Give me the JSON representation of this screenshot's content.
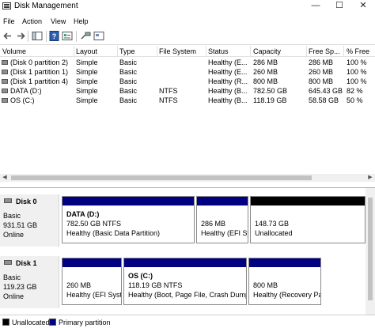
{
  "window": {
    "title": "Disk Management",
    "minimize": "—",
    "maximize": "☐",
    "close": "✕"
  },
  "menu": {
    "file": "File",
    "action": "Action",
    "view": "View",
    "help": "Help"
  },
  "columns": {
    "volume": "Volume",
    "layout": "Layout",
    "type": "Type",
    "fs": "File System",
    "status": "Status",
    "capacity": "Capacity",
    "free": "Free Sp...",
    "pct": "% Free"
  },
  "volumes": [
    {
      "volume": "(Disk 0 partition 2)",
      "layout": "Simple",
      "type": "Basic",
      "fs": "",
      "status": "Healthy (E...",
      "capacity": "286 MB",
      "free": "286 MB",
      "pct": "100 %"
    },
    {
      "volume": "(Disk 1 partition 1)",
      "layout": "Simple",
      "type": "Basic",
      "fs": "",
      "status": "Healthy (E...",
      "capacity": "260 MB",
      "free": "260 MB",
      "pct": "100 %"
    },
    {
      "volume": "(Disk 1 partition 4)",
      "layout": "Simple",
      "type": "Basic",
      "fs": "",
      "status": "Healthy (R...",
      "capacity": "800 MB",
      "free": "800 MB",
      "pct": "100 %"
    },
    {
      "volume": "DATA (D:)",
      "layout": "Simple",
      "type": "Basic",
      "fs": "NTFS",
      "status": "Healthy (B...",
      "capacity": "782.50 GB",
      "free": "645.43 GB",
      "pct": "82 %"
    },
    {
      "volume": "OS (C:)",
      "layout": "Simple",
      "type": "Basic",
      "fs": "NTFS",
      "status": "Healthy (B...",
      "capacity": "118.19 GB",
      "free": "58.58 GB",
      "pct": "50 %"
    }
  ],
  "disks": [
    {
      "name": "Disk 0",
      "kind": "Basic",
      "size": "931.51 GB",
      "state": "Online",
      "partitions": [
        {
          "name": "DATA  (D:)",
          "line1": "782.50 GB NTFS",
          "line2": "Healthy (Basic Data Partition)"
        },
        {
          "name": "",
          "line1": "286 MB",
          "line2": "Healthy (EFI Sy"
        },
        {
          "name": "",
          "line1": "148.73 GB",
          "line2": "Unallocated"
        }
      ]
    },
    {
      "name": "Disk 1",
      "kind": "Basic",
      "size": "119.23 GB",
      "state": "Online",
      "partitions": [
        {
          "name": "",
          "line1": "260 MB",
          "line2": "Healthy (EFI Syst"
        },
        {
          "name": "OS  (C:)",
          "line1": "118.19 GB NTFS",
          "line2": "Healthy (Boot, Page File, Crash Dump,"
        },
        {
          "name": "",
          "line1": "800 MB",
          "line2": "Healthy (Recovery Pa"
        }
      ]
    }
  ],
  "legend": {
    "unallocated": "Unallocated",
    "primary": "Primary partition"
  },
  "colors": {
    "primary": "#000080",
    "unallocated": "#000000"
  }
}
